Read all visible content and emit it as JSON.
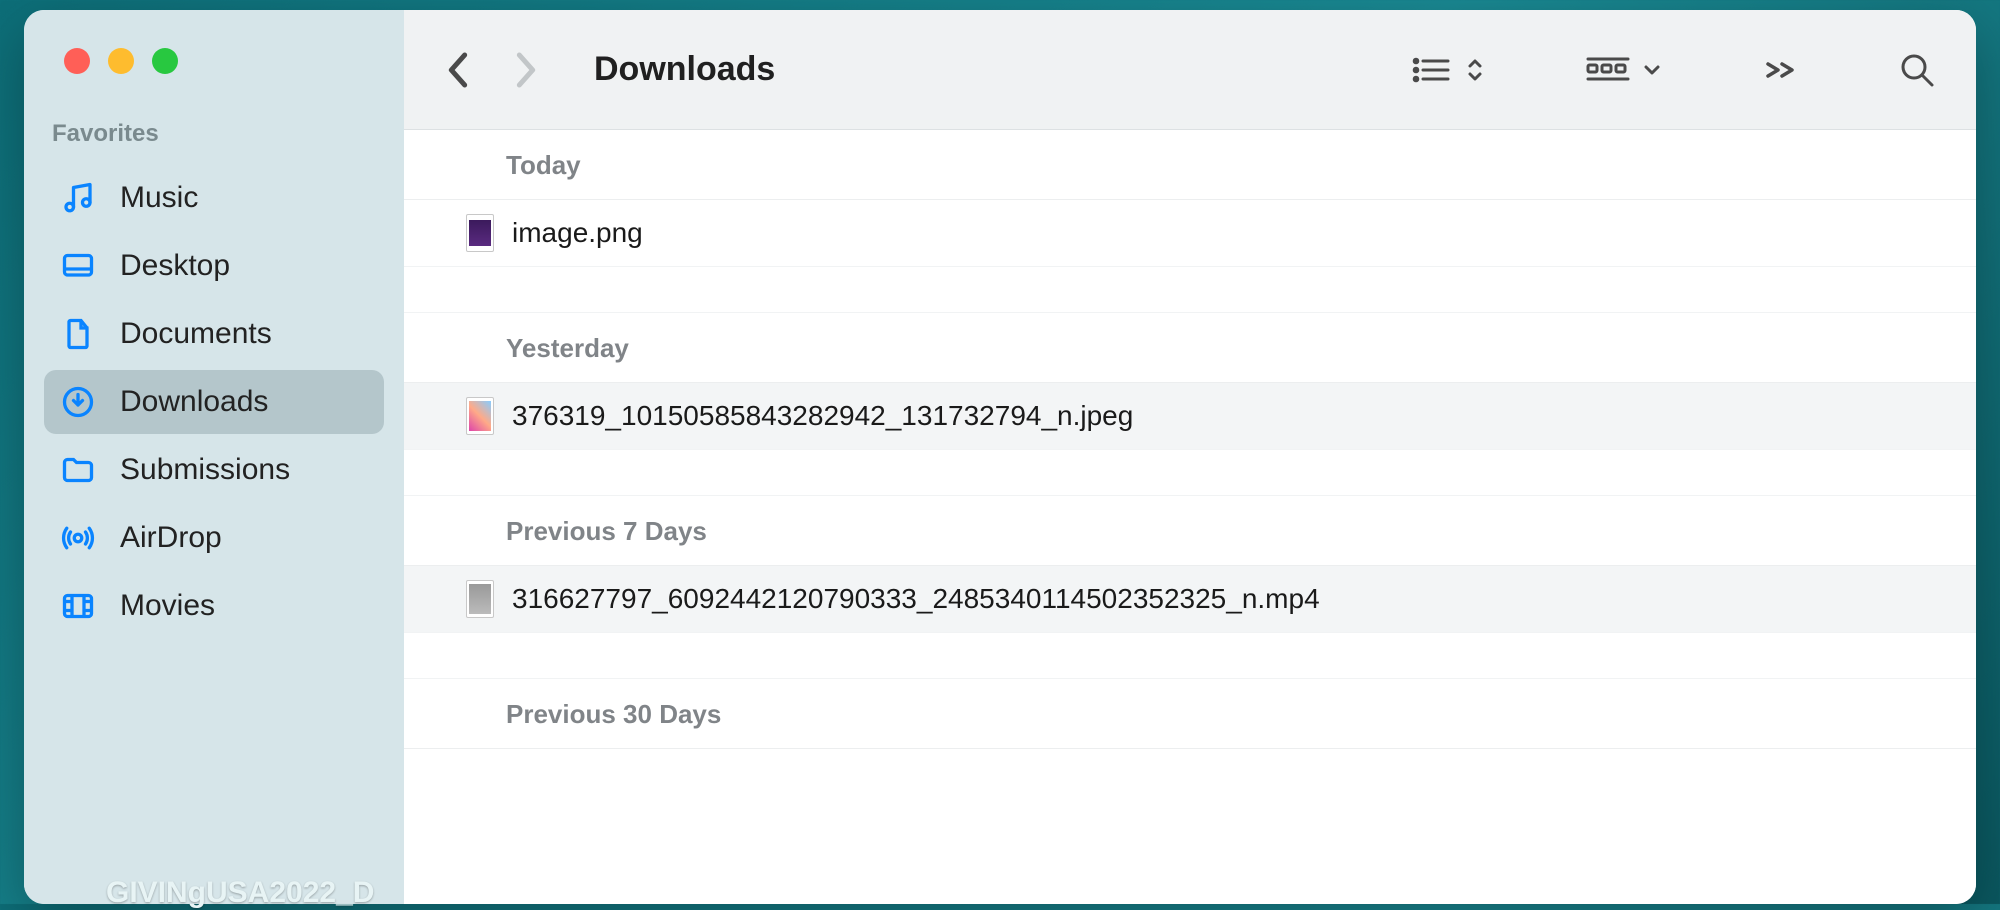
{
  "sidebar": {
    "section": "Favorites",
    "items": [
      {
        "label": "Music",
        "icon": "music"
      },
      {
        "label": "Desktop",
        "icon": "desktop"
      },
      {
        "label": "Documents",
        "icon": "document"
      },
      {
        "label": "Downloads",
        "icon": "download",
        "active": true
      },
      {
        "label": "Submissions",
        "icon": "folder"
      },
      {
        "label": "AirDrop",
        "icon": "airdrop"
      },
      {
        "label": "Movies",
        "icon": "movies"
      }
    ]
  },
  "toolbar": {
    "title": "Downloads"
  },
  "groups": [
    {
      "header": "Today",
      "files": [
        {
          "name": "image.png",
          "thumb": "purple"
        }
      ]
    },
    {
      "header": "Yesterday",
      "files": [
        {
          "name": "376319_10150585843282942_131732794_n.jpeg",
          "thumb": "photo"
        }
      ]
    },
    {
      "header": "Previous 7 Days",
      "files": [
        {
          "name": "316627797_6092442120790333_2485340114502352325_n.mp4",
          "thumb": "video"
        }
      ]
    },
    {
      "header": "Previous 30 Days",
      "files": []
    }
  ],
  "desktop": {
    "partial_filename": "GIVINgUSA2022_D"
  }
}
